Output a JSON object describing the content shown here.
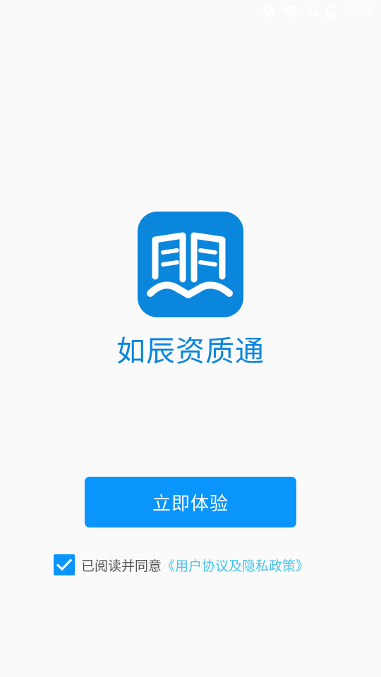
{
  "status_bar": {
    "time": "2:52",
    "icons": [
      "location-icon",
      "wifi-icon",
      "phone-icon",
      "battery-icon"
    ]
  },
  "app": {
    "name": "如辰资质通",
    "logo_icon": "book-logo-icon",
    "brand_color": "#0a86dc"
  },
  "start_button": {
    "label": "立即体验",
    "color": "#0995fb"
  },
  "agreement": {
    "checked": true,
    "text": "已阅读并同意",
    "link_text": "《用户协议及隐私政策》",
    "link_color": "#45c4ec"
  }
}
